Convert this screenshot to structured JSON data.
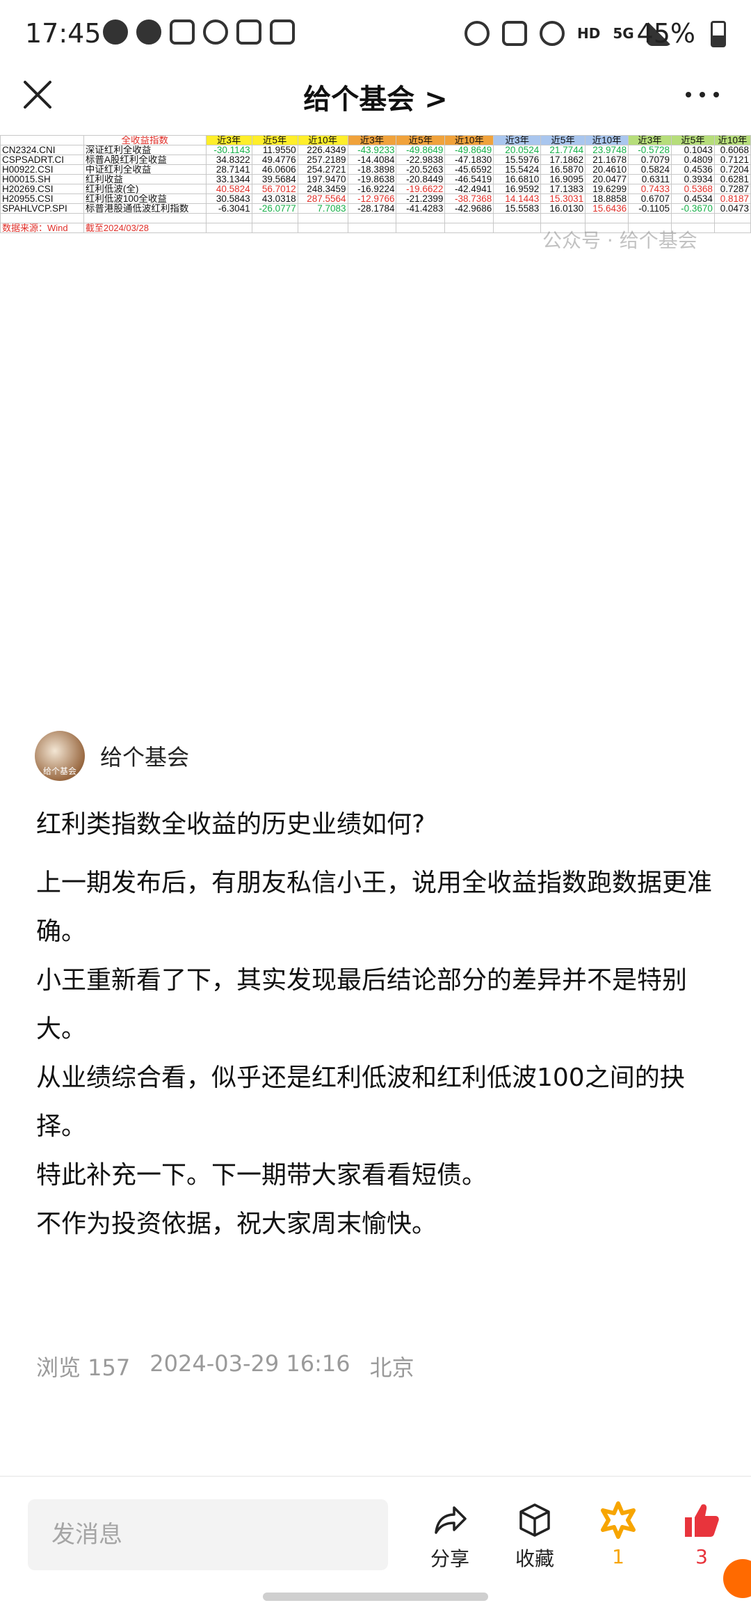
{
  "status_bar": {
    "time": "17:45",
    "network": "HD",
    "net_gen": "5G",
    "battery": "45%"
  },
  "nav": {
    "title": "给个基会 >"
  },
  "sheet": {
    "header_label": "全收益指数",
    "col_headers": [
      "近3年",
      "近5年",
      "近10年",
      "近3年",
      "近5年",
      "近10年",
      "近3年",
      "近5年",
      "近10年",
      "近3年",
      "近5年",
      "近10年"
    ],
    "header_colors": [
      "#ffee2a",
      "#ffee2a",
      "#ffee2a",
      "#f0a23b",
      "#f0a23b",
      "#f0a23b",
      "#a9c6ee",
      "#a9c6ee",
      "#a9c6ee",
      "#b6dd7a",
      "#b6dd7a",
      "#b6dd7a"
    ],
    "rows": [
      {
        "code": "CN2324.CNI",
        "name": "深证红利全收益",
        "values": [
          "-30.1143",
          "11.9550",
          "226.4349",
          "-43.9233",
          "-49.8649",
          "-49.8649",
          "20.0524",
          "21.7744",
          "23.9748",
          "-0.5728",
          "0.1043",
          "0.6068"
        ],
        "colors": [
          "green",
          "",
          "",
          "green",
          "green",
          "green",
          "green",
          "green",
          "green",
          "green",
          "",
          ""
        ]
      },
      {
        "code": "CSPSADRT.CI",
        "name": "标普A股红利全收益",
        "values": [
          "34.8322",
          "49.4776",
          "257.2189",
          "-14.4084",
          "-22.9838",
          "-47.1830",
          "15.5976",
          "17.1862",
          "21.1678",
          "0.7079",
          "0.4809",
          "0.7121"
        ],
        "colors": [
          "",
          "",
          "",
          "",
          "",
          "",
          "",
          "",
          "",
          "",
          "",
          ""
        ]
      },
      {
        "code": "H00922.CSI",
        "name": "中证红利全收益",
        "values": [
          "28.7141",
          "46.0606",
          "254.2721",
          "-18.3898",
          "-20.5263",
          "-45.6592",
          "15.5424",
          "16.5870",
          "20.4610",
          "0.5824",
          "0.4536",
          "0.7204"
        ],
        "colors": [
          "",
          "",
          "",
          "",
          "",
          "",
          "",
          "",
          "",
          "",
          "",
          ""
        ]
      },
      {
        "code": "H00015.SH",
        "name": "红利收益",
        "values": [
          "33.1344",
          "39.5684",
          "197.9470",
          "-19.8638",
          "-20.8449",
          "-46.5419",
          "16.6810",
          "16.9095",
          "20.0477",
          "0.6311",
          "0.3934",
          "0.6281"
        ],
        "colors": [
          "",
          "",
          "",
          "",
          "",
          "",
          "",
          "",
          "",
          "",
          "",
          ""
        ]
      },
      {
        "code": "H20269.CSI",
        "name": "红利低波(全)",
        "values": [
          "40.5824",
          "56.7012",
          "248.3459",
          "-16.9224",
          "-19.6622",
          "-42.4941",
          "16.9592",
          "17.1383",
          "19.6299",
          "0.7433",
          "0.5368",
          "0.7287"
        ],
        "colors": [
          "red",
          "red",
          "",
          "",
          "red",
          "",
          "",
          "",
          "",
          "red",
          "red",
          ""
        ]
      },
      {
        "code": "H20955.CSI",
        "name": "红利低波100全收益",
        "values": [
          "30.5843",
          "43.0318",
          "287.5564",
          "-12.9766",
          "-21.2399",
          "-38.7368",
          "14.1443",
          "15.3031",
          "18.8858",
          "0.6707",
          "0.4534",
          "0.8187"
        ],
        "colors": [
          "",
          "",
          "red",
          "red",
          "",
          "red",
          "red",
          "red",
          "",
          "",
          "",
          "red"
        ]
      },
      {
        "code": "SPAHLVCP.SPI",
        "name": "标普港股通低波红利指数",
        "values": [
          "-6.3041",
          "-26.0777",
          "7.7083",
          "-28.1784",
          "-41.4283",
          "-42.9686",
          "15.5583",
          "16.0130",
          "15.6436",
          "-0.1105",
          "-0.3670",
          "0.0473"
        ],
        "colors": [
          "",
          "green",
          "green",
          "",
          "",
          "",
          "",
          "",
          "red",
          "",
          "green",
          ""
        ]
      }
    ],
    "source_text": "数据来源：Wind",
    "date_text": "截至2024/03/28",
    "watermark": "公众号 · 给个基会"
  },
  "author": {
    "name": "给个基会",
    "avatar_caption": "给个基会"
  },
  "post": {
    "title": "红利类指数全收益的历史业绩如何?",
    "paragraphs": [
      "上一期发布后，有朋友私信小王，说用全收益指数跑数据更准确。",
      "小王重新看了下，其实发现最后结论部分的差异并不是特别大。",
      "从业绩综合看，似乎还是红利低波和红利低波100之间的抉择。",
      "特此补充一下。下一期带大家看看短债。",
      "不作为投资依据，祝大家周末愉快。"
    ]
  },
  "meta": {
    "views": "浏览 157",
    "datetime": "2024-03-29 16:16",
    "location": "北京"
  },
  "bottom": {
    "message_placeholder": "发消息",
    "share_label": "分享",
    "collect_label": "收藏",
    "reward_count": "1",
    "like_count": "3",
    "accent": "#f7a500",
    "like_color": "#e8343c"
  }
}
